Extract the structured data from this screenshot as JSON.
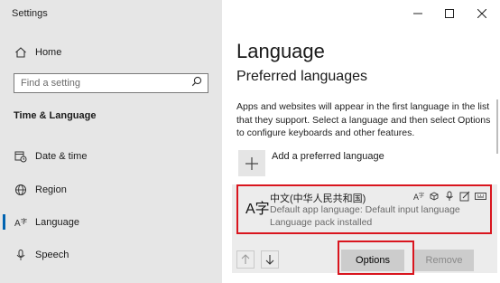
{
  "window": {
    "title": "Settings"
  },
  "sidebar": {
    "home_label": "Home",
    "search_placeholder": "Find a setting",
    "section_title": "Time & Language",
    "items": [
      {
        "label": "Date & time",
        "icon": "calendar-clock-icon"
      },
      {
        "label": "Region",
        "icon": "globe-icon"
      },
      {
        "label": "Language",
        "icon": "language-icon",
        "active": true
      },
      {
        "label": "Speech",
        "icon": "microphone-icon"
      }
    ]
  },
  "main": {
    "title": "Language",
    "subtitle": "Preferred languages",
    "description": "Apps and websites will appear in the first language in the list that they support. Select a language and then select Options to configure keyboards and other features.",
    "add_label": "Add a preferred language",
    "language": {
      "glyph": "A字",
      "name": "中文(中华人民共和国)",
      "line1": "Default app language: Default input language",
      "line2": "Language pack installed",
      "feature_icons": [
        "display-language-icon",
        "speech-icon",
        "microphone-icon",
        "handwriting-icon",
        "keyboard-icon"
      ]
    },
    "buttons": {
      "options": "Options",
      "remove": "Remove"
    }
  },
  "colors": {
    "highlight": "#d9151e",
    "accent": "#0063b1",
    "sidebar_bg": "#e6e6e6"
  }
}
